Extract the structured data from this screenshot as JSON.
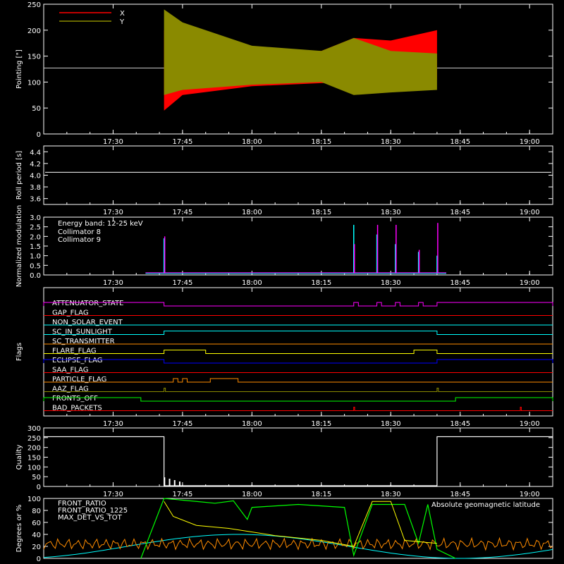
{
  "chart_data": [
    {
      "type": "line",
      "panel": "pointing",
      "ylabel": "Pointing [\"]",
      "ylim": [
        0,
        250
      ],
      "yticks": [
        "0",
        "50",
        "100",
        "150",
        "200",
        "250"
      ],
      "xticks": [
        "17:30",
        "17:45",
        "18:00",
        "18:15",
        "18:30",
        "18:45",
        "19:00"
      ],
      "reference_line": 127,
      "series": [
        {
          "name": "X",
          "color": "#ff0000",
          "x": [
            "17:41",
            "17:45",
            "18:00",
            "18:15",
            "18:22",
            "18:30",
            "18:40"
          ],
          "min": [
            45,
            75,
            92,
            98,
            100,
            102,
            105
          ],
          "max": [
            200,
            175,
            160,
            160,
            185,
            180,
            200
          ]
        },
        {
          "name": "Y",
          "color": "#8a8a00",
          "x": [
            "17:41",
            "17:45",
            "18:00",
            "18:15",
            "18:22",
            "18:30",
            "18:40"
          ],
          "min": [
            75,
            85,
            95,
            100,
            75,
            80,
            85
          ],
          "max": [
            240,
            215,
            170,
            160,
            185,
            160,
            155
          ]
        }
      ]
    },
    {
      "type": "line",
      "panel": "roll",
      "ylabel": "Roll period [s]",
      "ylim": [
        3.5,
        4.5
      ],
      "yticks": [
        "3.6",
        "3.8",
        "4.0",
        "4.2",
        "4.4"
      ],
      "xticks": [
        "17:30",
        "17:45",
        "18:00",
        "18:15",
        "18:30",
        "18:45",
        "19:00"
      ],
      "series": [
        {
          "name": "",
          "color": "#ffffff",
          "value": 4.05
        }
      ]
    },
    {
      "type": "line",
      "panel": "modulation",
      "ylabel": "Normalized modulation",
      "ylim": [
        0,
        3.0
      ],
      "yticks": [
        "0.0",
        "0.5",
        "1.0",
        "1.5",
        "2.0",
        "2.5",
        "3.0"
      ],
      "xticks": [
        "17:30",
        "17:45",
        "18:00",
        "18:15",
        "18:30",
        "18:45",
        "19:00"
      ],
      "legend_title": "Energy band: 12-25 keV",
      "series": [
        {
          "name": "Collimator 8",
          "color": "#00ffff",
          "spikes_x": [
            "17:41",
            "18:22",
            "18:27",
            "18:31",
            "18:36",
            "18:40"
          ],
          "spikes_y": [
            1.9,
            2.6,
            2.1,
            1.6,
            1.2,
            1.0
          ]
        },
        {
          "name": "Collimator 9",
          "color": "#ff00ff",
          "spikes_x": [
            "17:41",
            "18:22",
            "18:27",
            "18:31",
            "18:36",
            "18:40"
          ],
          "spikes_y": [
            2.0,
            1.6,
            2.6,
            2.6,
            1.3,
            2.7
          ]
        }
      ]
    },
    {
      "type": "table",
      "panel": "flags",
      "ylabel": "Flags",
      "xticks": [
        "17:30",
        "17:45",
        "18:00",
        "18:15",
        "18:30",
        "18:45",
        "19:00"
      ],
      "flags": [
        {
          "name": "ATTENUATOR_STATE",
          "color": "#ff00ff",
          "on": [
            [
              "17:15",
              "17:41"
            ],
            [
              "18:22",
              "18:23"
            ],
            [
              "18:27",
              "18:28"
            ],
            [
              "18:31",
              "18:32"
            ],
            [
              "18:36",
              "18:37"
            ],
            [
              "18:40",
              "19:05"
            ]
          ]
        },
        {
          "name": "GAP_FLAG",
          "color": "#ff0000",
          "on": []
        },
        {
          "name": "NON_SOLAR_EVENT",
          "color": "#00ffff",
          "on": []
        },
        {
          "name": "SC_IN_SUNLIGHT",
          "color": "#00ffff",
          "on": [
            [
              "17:41",
              "18:40"
            ]
          ]
        },
        {
          "name": "SC_TRANSMITTER",
          "color": "#ff8c00",
          "on": []
        },
        {
          "name": "FLARE_FLAG",
          "color": "#ffff00",
          "on": [
            [
              "17:41",
              "17:50"
            ],
            [
              "18:35",
              "18:40"
            ]
          ]
        },
        {
          "name": "ECLIPSE_FLAG",
          "color": "#0000ff",
          "on": [
            [
              "17:15",
              "17:41"
            ],
            [
              "18:40",
              "19:05"
            ]
          ]
        },
        {
          "name": "SAA_FLAG",
          "color": "#ff0000",
          "on": []
        },
        {
          "name": "PARTICLE_FLAG",
          "color": "#ff8c00",
          "on": [
            [
              "17:43",
              "17:44"
            ],
            [
              "17:45",
              "17:46"
            ],
            [
              "17:51",
              "17:57"
            ]
          ]
        },
        {
          "name": "AAZ_FLAG",
          "color": "#8a8a00",
          "on": [
            [
              "17:41",
              "17:41.3"
            ],
            [
              "18:40",
              "18:40.3"
            ]
          ]
        },
        {
          "name": "FRONTS_OFF",
          "color": "#00ff00",
          "on": [
            [
              "17:15",
              "17:36"
            ],
            [
              "18:44",
              "19:05"
            ]
          ]
        },
        {
          "name": "BAD_PACKETS",
          "color": "#ff0000",
          "on": [
            [
              "18:22",
              "18:22.2"
            ],
            [
              "18:58",
              "18:58.2"
            ]
          ]
        }
      ]
    },
    {
      "type": "line",
      "panel": "quality",
      "ylabel": "Quality",
      "ylim": [
        0,
        300
      ],
      "yticks": [
        "0",
        "50",
        "100",
        "150",
        "200",
        "250",
        "300"
      ],
      "xticks": [
        "17:30",
        "17:45",
        "18:00",
        "18:15",
        "18:30",
        "18:45",
        "19:00"
      ],
      "series": [
        {
          "name": "",
          "color": "#ffffff",
          "high_before": "17:41",
          "high_after": "18:40",
          "value": 255
        }
      ]
    },
    {
      "type": "line",
      "panel": "ratios",
      "ylabel": "Degrees or %",
      "ylim": [
        0,
        100
      ],
      "yticks": [
        "0",
        "20",
        "40",
        "60",
        "80",
        "100"
      ],
      "xticks": [],
      "series": [
        {
          "name": "FRONT_RATIO",
          "color": "#ffff00"
        },
        {
          "name": "FRONT_RATIO_1225",
          "color": "#00ff00"
        },
        {
          "name": "MAX_DET_VS_TOT",
          "color": "#ff8c00"
        },
        {
          "name": "Absolute geomagnetic latitude",
          "color": "#00ffff"
        }
      ]
    }
  ]
}
